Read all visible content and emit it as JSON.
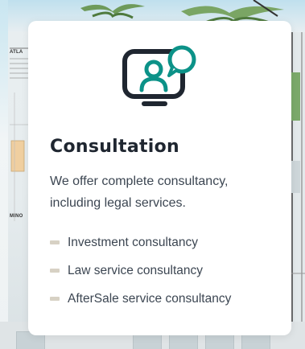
{
  "card": {
    "icon": "consultation-monitor-chat-icon",
    "title": "Consultation",
    "description": "We offer complete consultancy, including legal services.",
    "features": [
      "Investment consultancy",
      "Law service consultancy",
      "AfterSale service consultancy"
    ]
  },
  "background": {
    "plan_labels": [
      "ATLA",
      "MINO"
    ]
  },
  "colors": {
    "icon_dark": "#1f2630",
    "icon_accent": "#0c9288",
    "bullet": "#d7d1c4",
    "text": "#3c4652"
  }
}
